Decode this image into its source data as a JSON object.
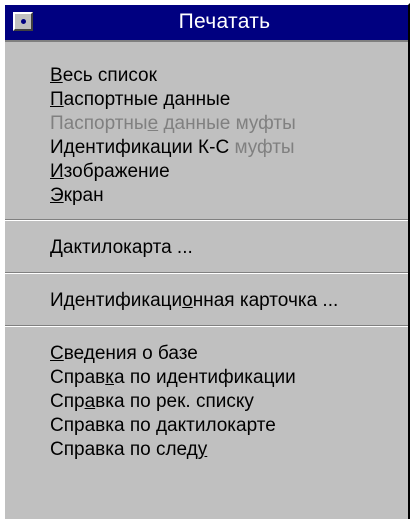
{
  "window": {
    "title": "Печатать"
  },
  "groups": [
    {
      "items": [
        {
          "pre": "",
          "key": "В",
          "post": "есь список",
          "disabled": false
        },
        {
          "pre": "",
          "key": "П",
          "post": "аспортные данные",
          "disabled": false
        },
        {
          "pre": "Паспортны",
          "key": "е",
          "post": " данные муфты",
          "disabled": true
        },
        {
          "segments": [
            "Идентификации К-С ",
            "муфты"
          ],
          "partially_disabled": true
        },
        {
          "pre": "",
          "key": "И",
          "post": "зображение",
          "disabled": false
        },
        {
          "pre": "",
          "key": "Э",
          "post": "кран",
          "disabled": false
        }
      ]
    },
    {
      "items": [
        {
          "pre": "",
          "key": "Д",
          "post": "актилокарта ...",
          "disabled": false
        }
      ]
    },
    {
      "items": [
        {
          "pre": "Идентификаци",
          "key": "о",
          "post": "нная карточка ...",
          "disabled": false
        }
      ]
    },
    {
      "items": [
        {
          "pre": "",
          "key": "С",
          "post": "ведения о базе",
          "disabled": false
        },
        {
          "pre": "Справ",
          "key": "к",
          "post": "а по идентификации",
          "disabled": false
        },
        {
          "pre": "Спр",
          "key": "а",
          "post": "вка по рек. списку",
          "disabled": false
        },
        {
          "pre": "Справка по дактилокарте",
          "key": "",
          "post": "",
          "disabled": false
        },
        {
          "pre": "Справка по след",
          "key": "у",
          "post": "",
          "disabled": false
        }
      ]
    }
  ],
  "colors": {
    "title_bar": "#000080",
    "menu_face": "#c0c0c0",
    "disabled_text": "#808080"
  },
  "icons": {
    "system_menu": "system-menu-icon"
  }
}
